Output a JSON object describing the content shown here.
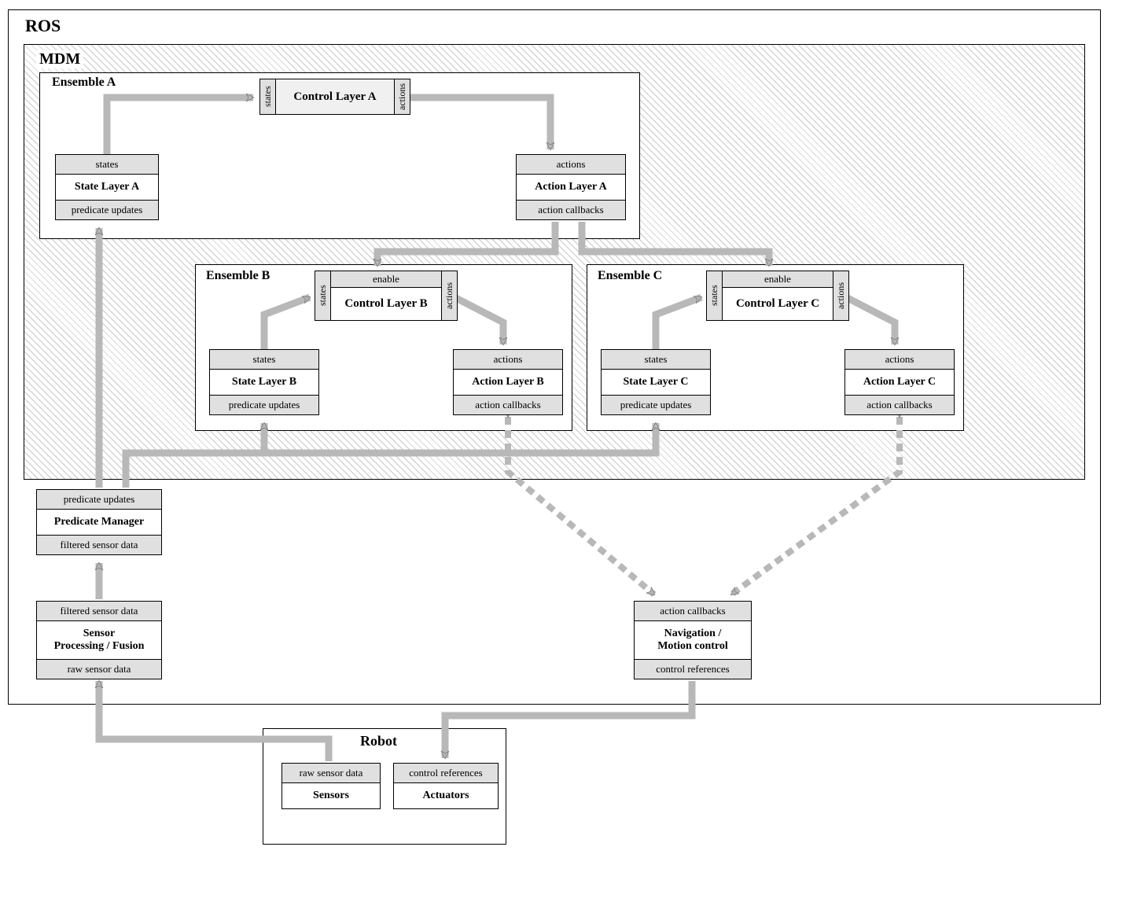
{
  "ros": {
    "title": "ROS"
  },
  "mdm": {
    "title": "MDM"
  },
  "ensembleA": {
    "title": "Ensemble A",
    "state": {
      "port_top": "states",
      "main": "State Layer A",
      "port_bot": "predicate updates"
    },
    "control": {
      "port_left": "states",
      "main": "Control Layer A",
      "port_right": "actions"
    },
    "action": {
      "port_top": "actions",
      "main": "Action Layer A",
      "port_bot": "action callbacks"
    }
  },
  "ensembleB": {
    "title": "Ensemble B",
    "state": {
      "port_top": "states",
      "main": "State Layer B",
      "port_bot": "predicate updates"
    },
    "control": {
      "enable": "enable",
      "port_left": "states",
      "main": "Control Layer B",
      "port_right": "actions"
    },
    "action": {
      "port_top": "actions",
      "main": "Action Layer B",
      "port_bot": "action callbacks"
    }
  },
  "ensembleC": {
    "title": "Ensemble C",
    "state": {
      "port_top": "states",
      "main": "State Layer C",
      "port_bot": "predicate updates"
    },
    "control": {
      "enable": "enable",
      "port_left": "states",
      "main": "Control Layer C",
      "port_right": "actions"
    },
    "action": {
      "port_top": "actions",
      "main": "Action Layer C",
      "port_bot": "action callbacks"
    }
  },
  "predmgr": {
    "port_top": "predicate updates",
    "main": "Predicate Manager",
    "port_bot": "filtered sensor data"
  },
  "sensorproc": {
    "port_top": "filtered sensor data",
    "main": "Sensor\nProcessing / Fusion",
    "port_bot": "raw sensor data"
  },
  "nav": {
    "port_top": "action callbacks",
    "main": "Navigation /\nMotion control",
    "port_bot": "control references"
  },
  "robot": {
    "title": "Robot",
    "sensors": {
      "port_top": "raw sensor data",
      "main": "Sensors"
    },
    "actuators": {
      "port_top": "control references",
      "main": "Actuators"
    }
  }
}
